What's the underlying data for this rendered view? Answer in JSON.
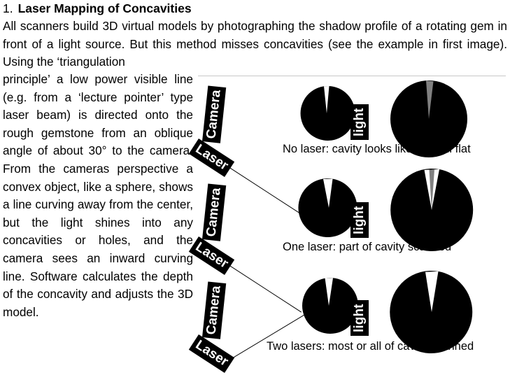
{
  "heading": {
    "number": "1.",
    "title": "Laser Mapping of Concavities"
  },
  "body": {
    "intro": "All scanners build 3D virtual models by photographing the shadow profile of a rotating gem in front of a light source. But this method misses concavities (see the example in first image). Using the ‘triangulation",
    "left_column": "principle’ a low power visible line (e.g. from a ‘lecture pointer’ type laser beam) is directed onto the rough gemstone from an oblique angle of about 30° to the camera. From the cameras perspective a convex object, like a sphere, shows a line curving away from the center, but the light shines into any concavities or holes, and the camera sees an inward curving line. Software calculates the depth of the concavity and adjusts the 3D model."
  },
  "figure": {
    "colors": {
      "label_background": "#000000",
      "label_text": "#ffffff",
      "gem_fill": "#000000",
      "sliver_fill": "#808080",
      "divider": "#c8c8c8",
      "background": "#ffffff"
    },
    "labels": {
      "camera": "Camera",
      "laser": "Laser",
      "light": "light"
    },
    "rows": [
      {
        "id": "row-no-laser",
        "caption": "No laser: cavity looks like a small flat",
        "camera_label": "Camera",
        "laser_label": "Laser",
        "light_label": "light",
        "laser_beams": 0
      },
      {
        "id": "row-one-laser",
        "caption": "One laser: part of cavity scanned",
        "camera_label": "Camera",
        "laser_label": "Laser",
        "light_label": "light",
        "laser_beams": 1
      },
      {
        "id": "row-two-lasers",
        "caption": "Two lasers: most or all of cavity scanned",
        "camera_label": "Camera",
        "laser_label": "Laser",
        "light_label": "light",
        "laser_beams": 2
      }
    ]
  }
}
